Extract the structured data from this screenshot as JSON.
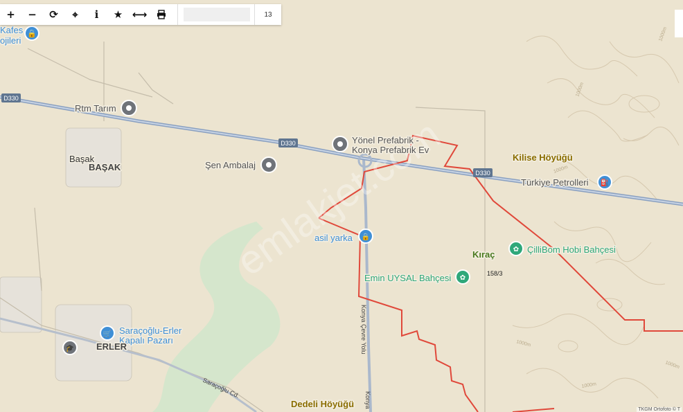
{
  "toolbar": {
    "buttons": [
      {
        "name": "zoom-in-button",
        "icon": "plus-icon",
        "glyph": "+"
      },
      {
        "name": "zoom-out-button",
        "icon": "minus-icon",
        "glyph": "−"
      },
      {
        "name": "refresh-button",
        "icon": "refresh-icon",
        "glyph": "⟳"
      },
      {
        "name": "locate-button",
        "icon": "crosshair-icon",
        "glyph": "⌖"
      },
      {
        "name": "info-button",
        "icon": "info-icon",
        "glyph": "i"
      },
      {
        "name": "favorite-button",
        "icon": "star-icon",
        "glyph": "★"
      },
      {
        "name": "measure-button",
        "icon": "double-arrow-icon",
        "glyph": "⟷"
      },
      {
        "name": "print-button",
        "icon": "printer-icon",
        "glyph": "🖶"
      }
    ],
    "zoom_level": "13"
  },
  "places": {
    "kafes_top": "Kafes",
    "kafes_bottom": "ojileri",
    "rtm": "Rtm Tarım",
    "basak": "Başak",
    "basak_caps": "BAŞAK",
    "sen": "Şen Ambalaj",
    "yonel_1": "Yönel Prefabrik -",
    "yonel_2": "Konya Prefabrik Ev",
    "kilise": "Kilise Höyüğü",
    "petrol": "Türkiye Petrolleri",
    "asil": "asil yarka",
    "cilli": "ÇilliBom Hobi Bahçesi",
    "kirac": "Kıraç",
    "parcel": "158/3",
    "emin": "Emin UYSAL Bahçesi",
    "saracoglu_1": "Saraçoğlu-Erler",
    "saracoglu_2": "Kapalı Pazarı",
    "erler": "ERLER",
    "saracoglu_cd": "Saraçoğlu Cd.",
    "konya_yolu": "Konya Çevre Yolu",
    "konya_short": "Konya",
    "dedeli": "Dedeli Höyüğü",
    "watermark": "emlakjet.com"
  },
  "roads": {
    "d330_a": "D330",
    "d330_b": "D330",
    "d330_c": "D330"
  },
  "contours": {
    "c1": "1000m",
    "c2": "1000m",
    "c3": "1000m",
    "c4": "1000m",
    "c5": "1000m",
    "c6": "1000m"
  },
  "attribution": "TKGM Ortofoto © T",
  "colors": {
    "parcel_border": "#e0483a",
    "road_highway": "#8aa0c0",
    "poi_blue": "#3f8fd6",
    "poi_green": "#2fa87a",
    "poi_gray": "#6f7379",
    "heritage_label": "#8a6d00"
  }
}
